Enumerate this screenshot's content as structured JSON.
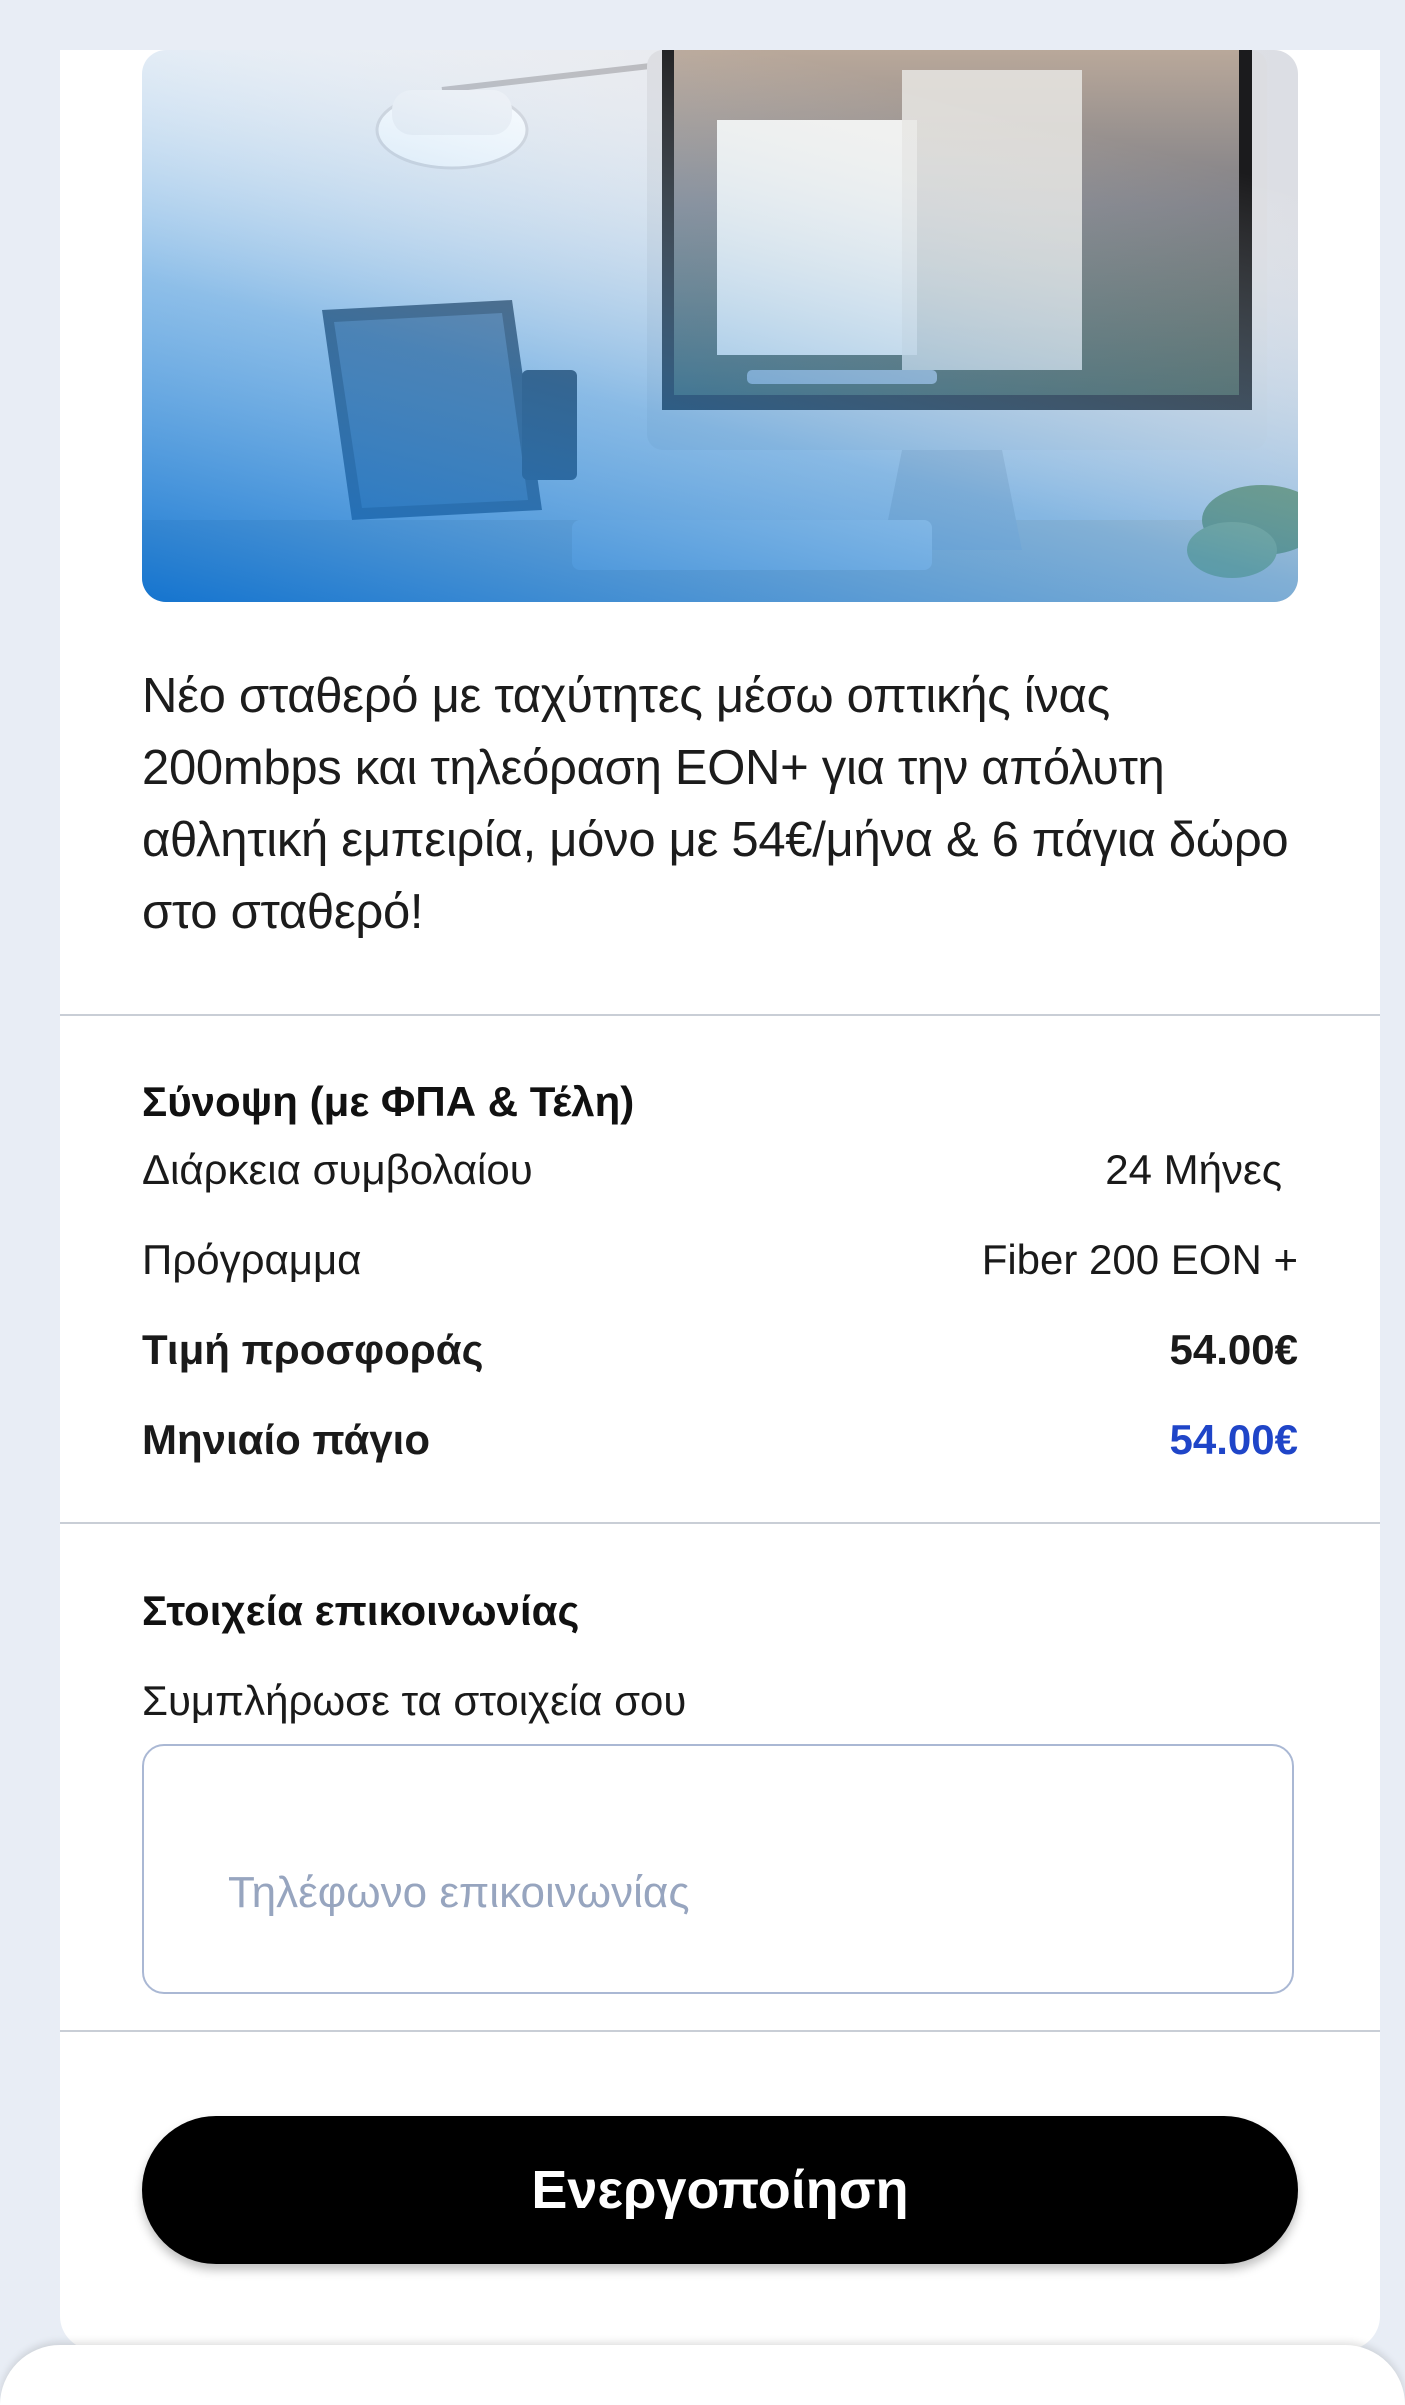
{
  "hero": {
    "image_alt": "Desk with desktop computer, laptop, lamp and plant",
    "gradient_color": "#1a7fd0"
  },
  "offer": {
    "description": "Νέο σταθερό με ταχύτητες μέσω οπτικής ίνας 200mbps και τηλεόραση EON+ για την απόλυτη αθλητική εμπειρία, μόνο με 54€/μήνα  & 6 πάγια δώρο στο σταθερό!"
  },
  "summary": {
    "title": "Σύνοψη (με ΦΠΑ & Τέλη)",
    "rows": [
      {
        "label": "Διάρκεια συμβολαίου",
        "value": "24 Μήνες"
      },
      {
        "label": "Πρόγραμμα",
        "value": "Fiber 200 EON +"
      },
      {
        "label": "Τιμή προσφοράς",
        "value": "54.00€"
      },
      {
        "label": "Μηνιαίο πάγιο",
        "value": "54.00€"
      }
    ]
  },
  "contact": {
    "title": "Στοιχεία επικοινωνίας",
    "subtitle": "Συμπλήρωσε τα στοιχεία σου",
    "phone_placeholder": "Τηλέφωνο επικοινωνίας",
    "phone_value": ""
  },
  "actions": {
    "activate_label": "Ενεργοποίηση"
  },
  "colors": {
    "accent": "#1f45c8",
    "button": "#000000",
    "background": "#e8edf5"
  }
}
